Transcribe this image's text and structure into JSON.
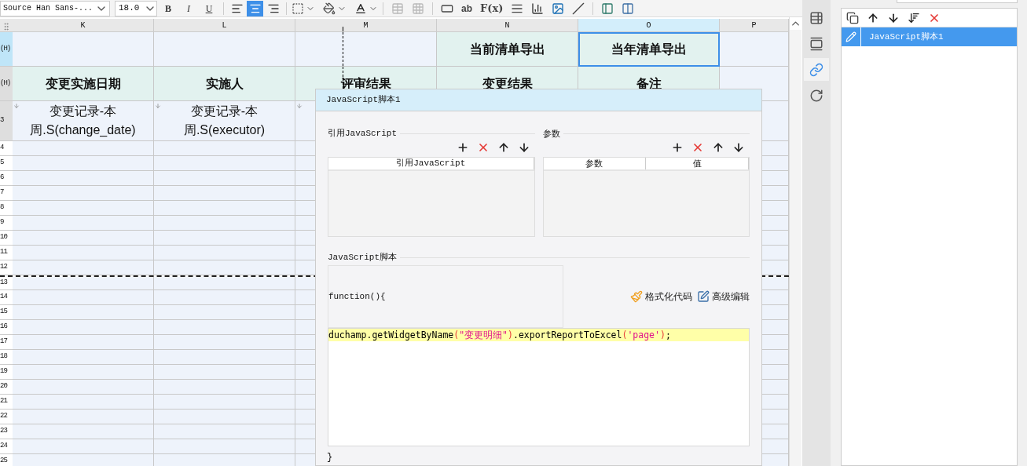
{
  "toolbar": {
    "font": "Source Han Sans-...",
    "size": "18.0",
    "style_buttons": [
      {
        "label": "B",
        "kind": "bold"
      },
      {
        "label": "I",
        "kind": "italic"
      },
      {
        "label": "U",
        "kind": "underline"
      }
    ],
    "align_buttons": [
      {
        "kind": "left",
        "selected": false
      },
      {
        "kind": "center",
        "selected": true
      },
      {
        "kind": "right",
        "selected": false
      }
    ],
    "text_tools": [
      {
        "label": "ab",
        "kind": "text"
      },
      {
        "label": "F(x)",
        "kind": "formula"
      }
    ]
  },
  "sheet": {
    "columns": [
      {
        "label": "K",
        "selected": false,
        "page_break": false
      },
      {
        "label": "L",
        "selected": false,
        "page_break": false
      },
      {
        "label": "M",
        "selected": false,
        "page_break": true
      },
      {
        "label": "N",
        "selected": false,
        "page_break": false
      },
      {
        "label": "O",
        "selected": true,
        "page_break": false
      },
      {
        "label": "P",
        "selected": false,
        "page_break": false
      }
    ],
    "rows": [
      {
        "header": "(H)",
        "kind": "title",
        "selected": true,
        "cells": [
          {
            "kind": "empty",
            "selected": false
          },
          {
            "kind": "empty",
            "selected": false
          },
          {
            "kind": "empty",
            "selected": false
          },
          {
            "kind": "text",
            "text": "当前清单导出",
            "selected": false
          },
          {
            "kind": "text",
            "text": "当年清单导出",
            "selected": true
          },
          {
            "kind": "empty",
            "selected": false
          }
        ]
      },
      {
        "header": "(H)",
        "kind": "heading",
        "selected": false,
        "cells": [
          {
            "kind": "text",
            "text": "变更实施日期",
            "selected": false
          },
          {
            "kind": "text",
            "text": "实施人",
            "selected": false
          },
          {
            "kind": "text",
            "text": "评审结果",
            "selected": false
          },
          {
            "kind": "text",
            "text": "变更结果",
            "selected": false
          },
          {
            "kind": "text",
            "text": "备注",
            "selected": false
          },
          {
            "kind": "empty",
            "selected": false
          }
        ]
      },
      {
        "header": "3",
        "kind": "data",
        "selected": false,
        "cells": [
          {
            "kind": "text",
            "text": "变更记录-本周.S(change_date)",
            "expand": true,
            "selected": false
          },
          {
            "kind": "text",
            "text": "变更记录-本周.S(executor)",
            "expand": true,
            "selected": false
          },
          {
            "kind": "empty",
            "expand": true,
            "selected": false
          },
          {
            "kind": "empty"
          },
          {
            "kind": "empty"
          },
          {
            "kind": "empty",
            "selected": false
          }
        ]
      },
      {
        "header": "4",
        "kind": "blank"
      },
      {
        "header": "5",
        "kind": "blank"
      },
      {
        "header": "6",
        "kind": "blank"
      },
      {
        "header": "7",
        "kind": "blank"
      },
      {
        "header": "8",
        "kind": "blank"
      },
      {
        "header": "9",
        "kind": "blank"
      },
      {
        "header": "10",
        "kind": "blank"
      },
      {
        "header": "11",
        "kind": "blank"
      },
      {
        "header": "12",
        "kind": "blank"
      },
      {
        "header": "13",
        "kind": "blank",
        "page_break": true
      },
      {
        "header": "14",
        "kind": "blank"
      },
      {
        "header": "15",
        "kind": "blank"
      },
      {
        "header": "16",
        "kind": "blank"
      },
      {
        "header": "17",
        "kind": "blank"
      },
      {
        "header": "18",
        "kind": "blank"
      },
      {
        "header": "19",
        "kind": "blank"
      },
      {
        "header": "20",
        "kind": "blank"
      },
      {
        "header": "21",
        "kind": "blank"
      },
      {
        "header": "22",
        "kind": "blank"
      },
      {
        "header": "23",
        "kind": "blank"
      },
      {
        "header": "24",
        "kind": "blank"
      },
      {
        "header": "25",
        "kind": "blank"
      }
    ]
  },
  "dialog": {
    "title": "JavaScript脚本1",
    "import_section": {
      "title": "引用JavaScript",
      "columns": [
        "引用JavaScript"
      ]
    },
    "params_section": {
      "title": "参数",
      "columns": [
        "参数",
        "值"
      ]
    },
    "script_section": {
      "title": "JavaScript脚本",
      "header": "function(){",
      "footer": "}",
      "actions": [
        {
          "label": "格式化代码",
          "kind": "format"
        },
        {
          "label": "高级编辑",
          "kind": "edit"
        }
      ],
      "code": [
        {
          "text": "duchamp.getWidgetByName",
          "kind": "plain"
        },
        {
          "text": "(",
          "kind": "paren"
        },
        {
          "text": "\"变更明细\"",
          "kind": "string"
        },
        {
          "text": ")",
          "kind": "paren"
        },
        {
          "text": ".exportReportToExcel",
          "kind": "plain"
        },
        {
          "text": "(",
          "kind": "paren"
        },
        {
          "text": "'page'",
          "kind": "string"
        },
        {
          "text": ")",
          "kind": "paren"
        },
        {
          "text": ";",
          "kind": "plain"
        }
      ]
    }
  },
  "side_tabs": [
    {
      "kind": "cell",
      "selected": false
    },
    {
      "kind": "widget",
      "selected": false
    },
    {
      "kind": "link",
      "selected": true
    },
    {
      "kind": "rotate",
      "selected": false
    }
  ],
  "events": {
    "items": [
      {
        "label": "JavaScript脚本1",
        "selected": true
      }
    ]
  }
}
